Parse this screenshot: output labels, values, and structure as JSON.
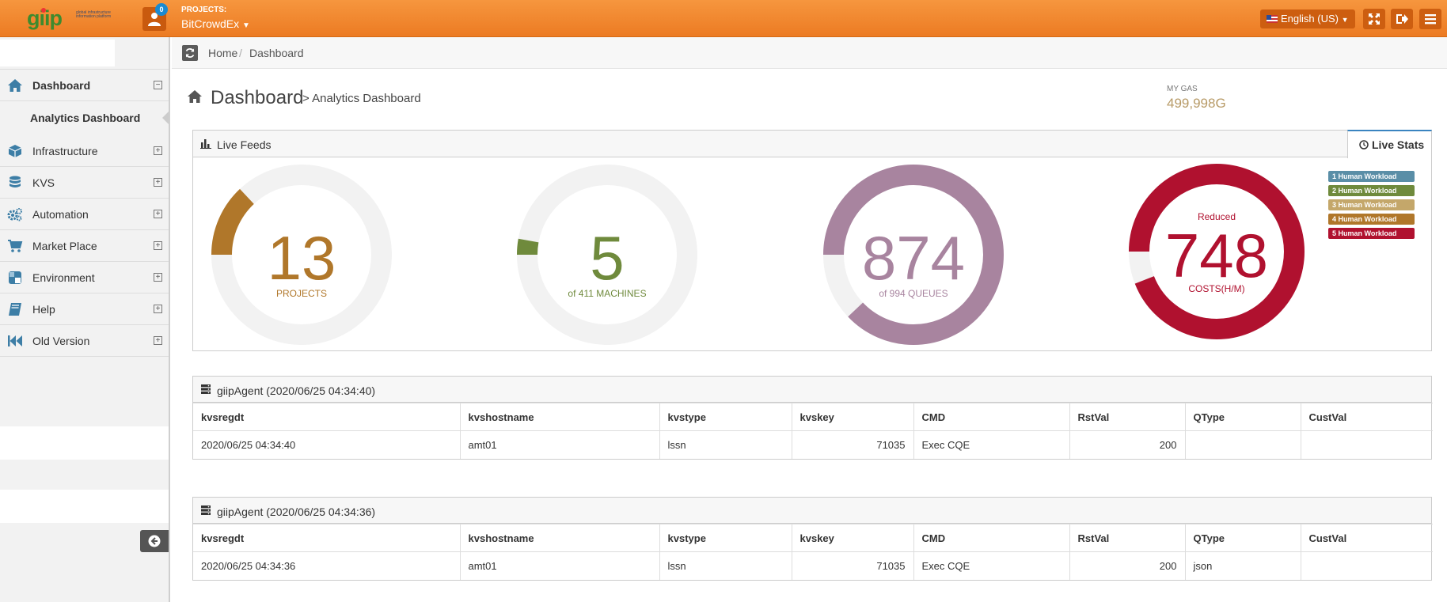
{
  "header": {
    "logo_text": "giip",
    "logo_tagline": "global infrastructure information platform",
    "user_badge": "0",
    "projects_label": "PROJECTS:",
    "project_name": "BitCrowdEx",
    "language": "English (US)"
  },
  "sidebar": {
    "items": [
      {
        "label": "Dashboard"
      },
      {
        "label": "Infrastructure"
      },
      {
        "label": "KVS"
      },
      {
        "label": "Automation"
      },
      {
        "label": "Market Place"
      },
      {
        "label": "Environment"
      },
      {
        "label": "Help"
      },
      {
        "label": "Old Version"
      }
    ],
    "sub_item": "Analytics Dashboard"
  },
  "breadcrumb": {
    "home": "Home",
    "sep": "/",
    "current": "Dashboard"
  },
  "page": {
    "title": "Dashboard",
    "subtitle": "> Analytics Dashboard",
    "gas_label": "MY GAS",
    "gas_value": "499,998G"
  },
  "feeds": {
    "title": "Live Feeds",
    "tab_live_stats": "Live Stats",
    "gauges": [
      {
        "value": "13",
        "label": "PROJECTS",
        "color": "#b0772a",
        "fraction": 0.13
      },
      {
        "value": "5",
        "label": "of 411 MACHINES",
        "color": "#6f8a3c",
        "fraction": 0.012
      },
      {
        "value": "874",
        "label": "of 994 QUEUES",
        "color": "#a8849f",
        "fraction": 0.879
      },
      {
        "value": "748",
        "label": "COSTS(H/M)",
        "top_label": "Reduced",
        "color": "#b0112f",
        "fraction": 0.94
      }
    ],
    "legend": [
      {
        "label": "1 Human Workload",
        "color": "#5a8ea7"
      },
      {
        "label": "2 Human Workload",
        "color": "#6f8a3c"
      },
      {
        "label": "3 Human Workload",
        "color": "#c4a76a"
      },
      {
        "label": "4 Human Workload",
        "color": "#b0772a"
      },
      {
        "label": "5 Human Workload",
        "color": "#b0112f"
      }
    ]
  },
  "tables": [
    {
      "title": "giipAgent (2020/06/25 04:34:40)",
      "columns": [
        "kvsregdt",
        "kvshostname",
        "kvstype",
        "kvskey",
        "CMD",
        "RstVal",
        "QType",
        "CustVal"
      ],
      "rows": [
        [
          "2020/06/25 04:34:40",
          "amt01",
          "lssn",
          "71035",
          "Exec CQE",
          "200",
          "",
          ""
        ]
      ]
    },
    {
      "title": "giipAgent (2020/06/25 04:34:36)",
      "columns": [
        "kvsregdt",
        "kvshostname",
        "kvstype",
        "kvskey",
        "CMD",
        "RstVal",
        "QType",
        "CustVal"
      ],
      "rows": [
        [
          "2020/06/25 04:34:36",
          "amt01",
          "lssn",
          "71035",
          "Exec CQE",
          "200",
          "json",
          ""
        ]
      ]
    }
  ]
}
